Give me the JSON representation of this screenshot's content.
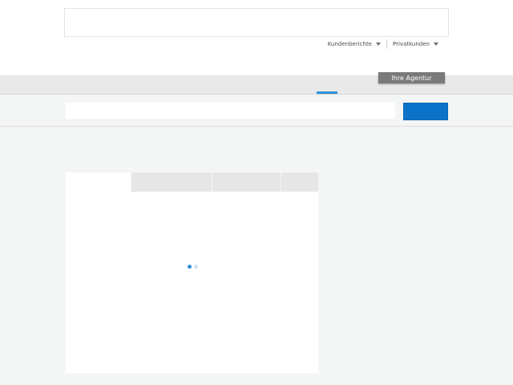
{
  "header": {
    "links": [
      {
        "label": "Kundenberichte",
        "icon": "chevron-down-icon"
      },
      {
        "label": "Privatkunden",
        "icon": "chevron-down-icon"
      }
    ],
    "agency_button": "Ihre Agentur"
  },
  "search": {
    "value": "",
    "placeholder": "",
    "button_label": ""
  },
  "tabs": [
    {
      "label": "",
      "active": true
    },
    {
      "label": "",
      "active": false
    },
    {
      "label": "",
      "active": false
    },
    {
      "label": "",
      "active": false
    }
  ],
  "colors": {
    "accent": "#0a72c9",
    "nav_indicator": "#2f8fd8",
    "agency_button_bg": "#7a7a7a",
    "page_bg": "#f4f5f5"
  }
}
